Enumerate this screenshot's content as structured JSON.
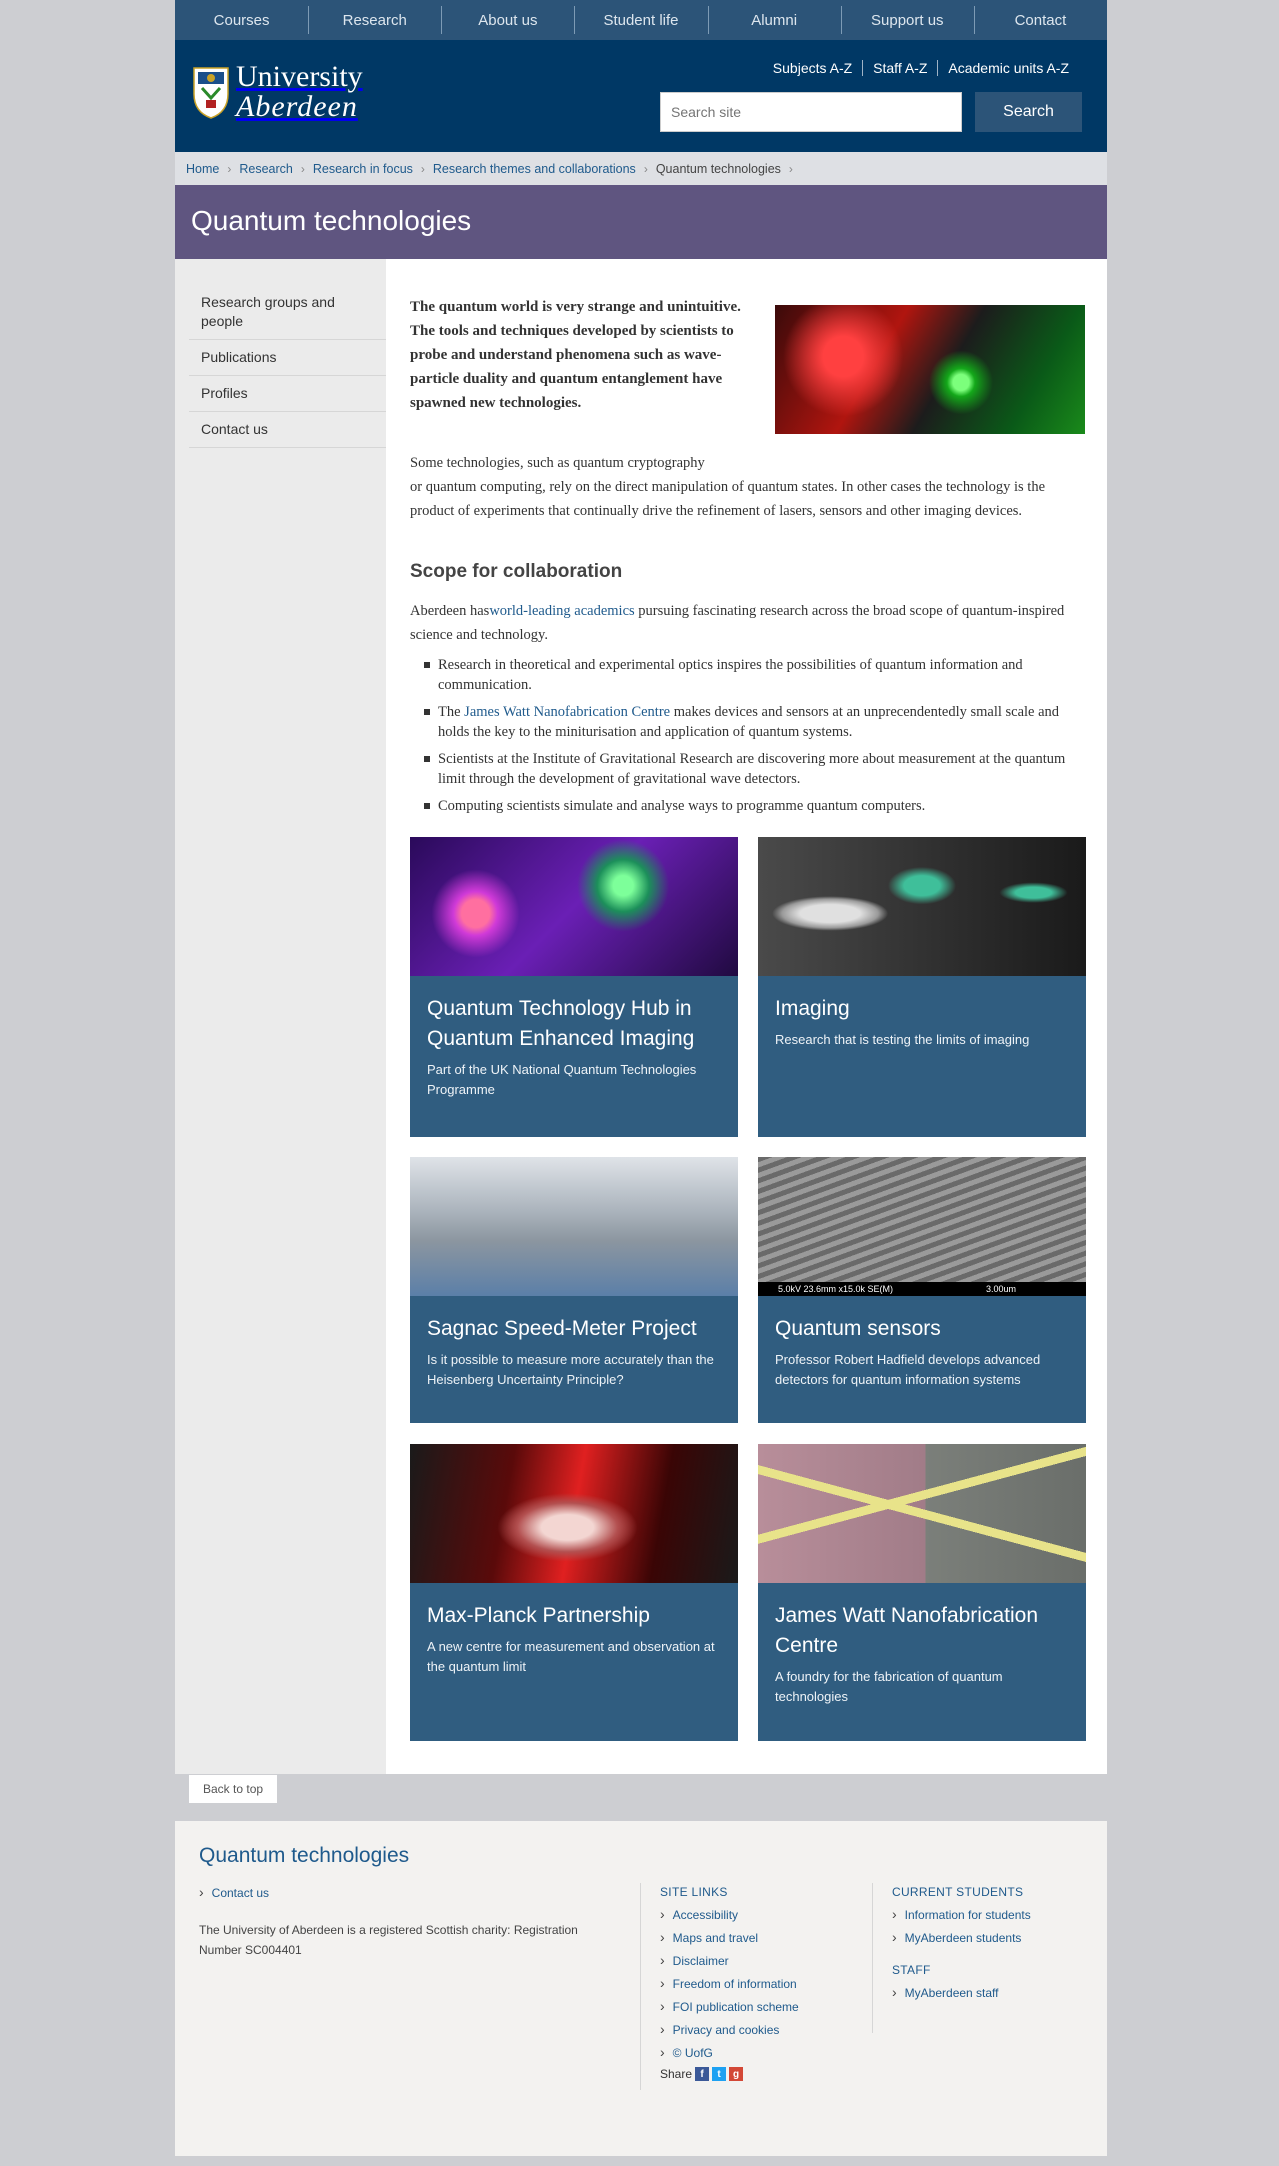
{
  "topnav": [
    "Courses",
    "Research",
    "About us",
    "Student life",
    "Alumni",
    "Support us",
    "Contact"
  ],
  "header": {
    "logo_line1": "University",
    "logo_line2": "Aberdeen",
    "util_links": [
      "Subjects A-Z",
      "Staff A-Z",
      "Academic units A-Z"
    ],
    "search_placeholder": "Search site",
    "search_button": "Search"
  },
  "breadcrumb": {
    "links": [
      "Home",
      "Research",
      "Research in focus",
      "Research themes and collaborations"
    ],
    "current": "Quantum technologies"
  },
  "page_title": "Quantum technologies",
  "sidebar": [
    "Research groups and people",
    "Publications",
    "Profiles",
    "Contact us"
  ],
  "content": {
    "intro": "The quantum world is very strange and unintuitive. The tools and techniques developed by scientists to probe and understand phenomena such as wave-particle duality and quantum entanglement have spawned new technologies.",
    "p1_line1": "Some technologies, such as quantum cryptography",
    "p1_rest": "or quantum computing, rely on the direct manipulation of quantum states. In other cases the technology is the product of experiments that continually drive the refinement of lasers, sensors and other imaging devices.",
    "heading": "Scope for collaboration",
    "p2_pre": "Aberdeen has",
    "p2_link": "world-leading academics",
    "p2_post": " pursuing fascinating research across the broad scope of quantum-inspired science and technology.",
    "bullet1": "Research in theoretical and experimental optics inspires the possibilities of quantum information and communication.",
    "bullet2_pre": "The ",
    "bullet2_link": "James Watt Nanofabrication Centre",
    "bullet2_post": " makes devices and sensors at an unprecendentedly small scale and holds the key to the miniturisation and application of quantum systems.",
    "bullet3": "Scientists at the Institute of Gravitational Research are discovering more about measurement at the quantum limit through the development of gravitational wave detectors.",
    "bullet4": "Computing scientists simulate and analyse ways to programme quantum computers."
  },
  "cards": [
    {
      "title": "Quantum Technology Hub in Quantum Enhanced Imaging",
      "desc": "Part of the UK National Quantum Technologies Programme"
    },
    {
      "title": "Imaging",
      "desc": "Research that is testing the limits of imaging"
    },
    {
      "title": "Sagnac Speed-Meter Project",
      "desc": "Is it possible to measure more accurately than the Heisenberg Uncertainty Principle?"
    },
    {
      "title": "Quantum sensors",
      "desc": "Professor Robert Hadfield develops advanced detectors for quantum information systems",
      "img_caption": "5.0kV 23.6mm x15.0k SE(M)",
      "img_scale": "3.00um"
    },
    {
      "title": "Max-Planck Partnership",
      "desc": "A new centre for measurement and observation at the quantum limit"
    },
    {
      "title": "James Watt Nanofabrication Centre",
      "desc": "A foundry for the fabrication of quantum technologies"
    }
  ],
  "back_to_top": "Back to top",
  "footer": {
    "title": "Quantum technologies",
    "contact": "Contact us",
    "charity": "The University of Aberdeen is a registered Scottish charity: Registration Number SC004401",
    "site_links_heading": "SITE LINKS",
    "site_links": [
      "Accessibility",
      "Maps and travel",
      "Disclaimer",
      "Freedom of information",
      "FOI publication scheme",
      "Privacy and cookies",
      "© UofG"
    ],
    "share_label": "Share",
    "current_students_heading": "CURRENT STUDENTS",
    "current_students": [
      "Information for students",
      "MyAberdeen students"
    ],
    "staff_heading": "STAFF",
    "staff": [
      "MyAberdeen staff"
    ]
  },
  "colors": {
    "nav": "#2c5478",
    "header": "#003865",
    "banner": "#5f5580",
    "card": "#305d80",
    "link": "#1f5a8c"
  }
}
